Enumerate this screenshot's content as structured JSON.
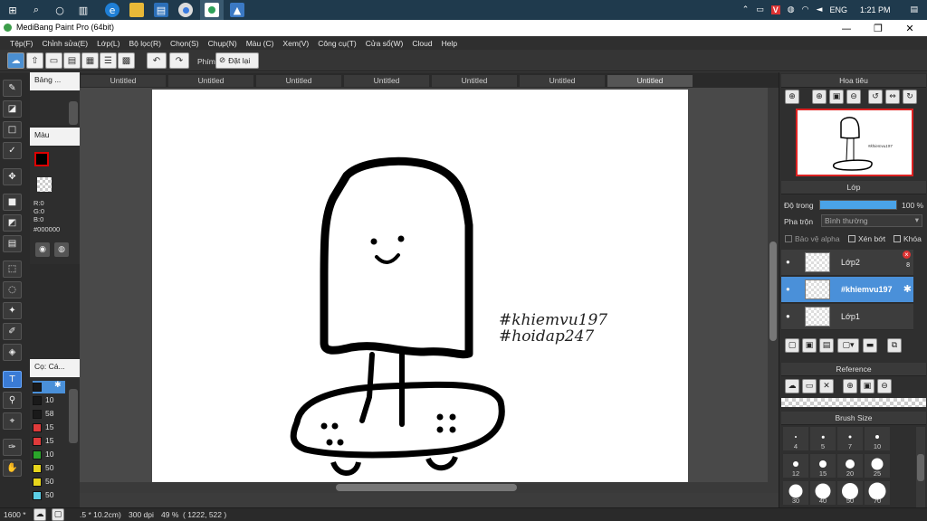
{
  "taskbar": {
    "time": "1:21 PM",
    "lang": "ENG",
    "icons": [
      "windows-icon",
      "search-icon",
      "cortana-icon",
      "task-view-icon",
      "edge-icon",
      "file-explorer-icon",
      "store-icon",
      "chrome-icon",
      "medibang-icon",
      "photos-icon"
    ]
  },
  "window": {
    "title": "MediBang Paint Pro (64bit)",
    "minimize": "—",
    "maximize": "❐",
    "close": "✕"
  },
  "menu": [
    "Tệp(F)",
    "Chỉnh sửa(E)",
    "Lớp(L)",
    "Bộ lọc(R)",
    "Chọn(S)",
    "Chụp(N)",
    "Màu (C)",
    "Xem(V)",
    "Công cụ(T)",
    "Cửa sổ(W)",
    "Cloud",
    "Help"
  ],
  "toolbar": {
    "pin_label": "Phím",
    "reset_label": "Đặt lại"
  },
  "panels": {
    "brush_panel": "Bảng ...",
    "color_panel": "Màu",
    "color_rgb": {
      "r": "R:0",
      "g": "G:0",
      "b": "B:0"
    },
    "color_hex": "#000000",
    "size_panel": "Cọ: Cá...",
    "sizes": [
      {
        "value": "",
        "color": "#1a1a1a"
      },
      {
        "value": "10",
        "color": "#1a1a1a"
      },
      {
        "value": "58",
        "color": "#1a1a1a"
      },
      {
        "value": "15",
        "color": "#e03b3b"
      },
      {
        "value": "15",
        "color": "#e03b3b"
      },
      {
        "value": "10",
        "color": "#2aa52a"
      },
      {
        "value": "50",
        "color": "#e8d61c"
      },
      {
        "value": "50",
        "color": "#e8d61c"
      },
      {
        "value": "50",
        "color": "#5ccfe6"
      }
    ]
  },
  "tabs": [
    "Untitled",
    "Untitled",
    "Untitled",
    "Untitled",
    "Untitled",
    "Untitled",
    "Untitled"
  ],
  "active_tab_index": 6,
  "canvas": {
    "watermark_line1": "#khiemvu197",
    "watermark_line2": "#hoidap247"
  },
  "navigator": {
    "title": "Hoa tiêu",
    "thumb_text": "#khiemvu197"
  },
  "layer_panel": {
    "title": "Lớp",
    "opacity_label": "Độ trong",
    "opacity_value": "100 %",
    "opacity": 1.0,
    "blend_label": "Pha trộn",
    "blend_value": "Bình thường",
    "protect_alpha": "Bảo vệ alpha",
    "clipping": "Xén bớt",
    "lock": "Khóa",
    "layers": [
      {
        "name": "Lớp2",
        "selected": false,
        "badge": "8"
      },
      {
        "name": "#khiemvu197",
        "selected": true,
        "badge": ""
      },
      {
        "name": "Lớp1",
        "selected": false,
        "badge": ""
      }
    ]
  },
  "reference": {
    "title": "Reference"
  },
  "brush_size": {
    "title": "Brush Size",
    "sizes": [
      "4",
      "5",
      "7",
      "10",
      "12",
      "15",
      "20",
      "25",
      "30",
      "40",
      "50",
      "70"
    ]
  },
  "status": {
    "zoom_left": "1600 *",
    "dimensions": ".5 * 10.2cm)",
    "dpi": "300 dpi",
    "zoom": "49 %",
    "coords": "( 1222, 522 )"
  }
}
